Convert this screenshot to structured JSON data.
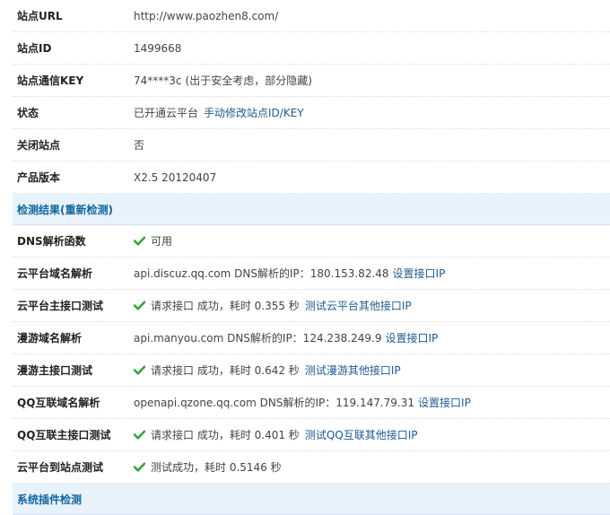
{
  "site_info": {
    "url_label": "站点URL",
    "url_value": "http://www.paozhen8.com/",
    "id_label": "站点ID",
    "id_value": "1499668",
    "key_label": "站点通信KEY",
    "key_value": "74****3c",
    "key_note": "(出于安全考虑，部分隐藏)",
    "status_label": "状态",
    "status_value": "已开通云平台",
    "status_link": "手动修改站点ID/KEY",
    "closed_label": "关闭站点",
    "closed_value": "否",
    "version_label": "产品版本",
    "version_value": "X2.5 20120407"
  },
  "results": {
    "header": "检测结果(重新检测)",
    "dns_func_label": "DNS解析函数",
    "dns_func_value": "可用",
    "cloud_domain_label": "云平台域名解析",
    "cloud_domain_value": "api.discuz.qq.com DNS解析的IP：180.153.82.48",
    "cloud_domain_link": "设置接口IP",
    "cloud_api_label": "云平台主接口测试",
    "cloud_api_value": "请求接口 成功，耗时 0.355 秒",
    "cloud_api_link": "测试云平台其他接口IP",
    "manyou_domain_label": "漫游域名解析",
    "manyou_domain_value": "api.manyou.com DNS解析的IP：124.238.249.9",
    "manyou_domain_link": "设置接口IP",
    "manyou_api_label": "漫游主接口测试",
    "manyou_api_value": "请求接口 成功，耗时 0.642 秒",
    "manyou_api_link": "测试漫游其他接口IP",
    "qq_domain_label": "QQ互联域名解析",
    "qq_domain_value": "openapi.qzone.qq.com DNS解析的IP：119.147.79.31",
    "qq_domain_link": "设置接口IP",
    "qq_api_label": "QQ互联主接口测试",
    "qq_api_value": "请求接口 成功，耗时 0.401 秒",
    "qq_api_link": "测试QQ互联其他接口IP",
    "cloud_to_site_label": "云平台到站点测试",
    "cloud_to_site_value": "测试成功，耗时 0.5146 秒"
  },
  "plugin_section": {
    "header": "系统插件检测"
  },
  "icons": {
    "check": "check-icon",
    "check_color": "#3aa63a"
  }
}
